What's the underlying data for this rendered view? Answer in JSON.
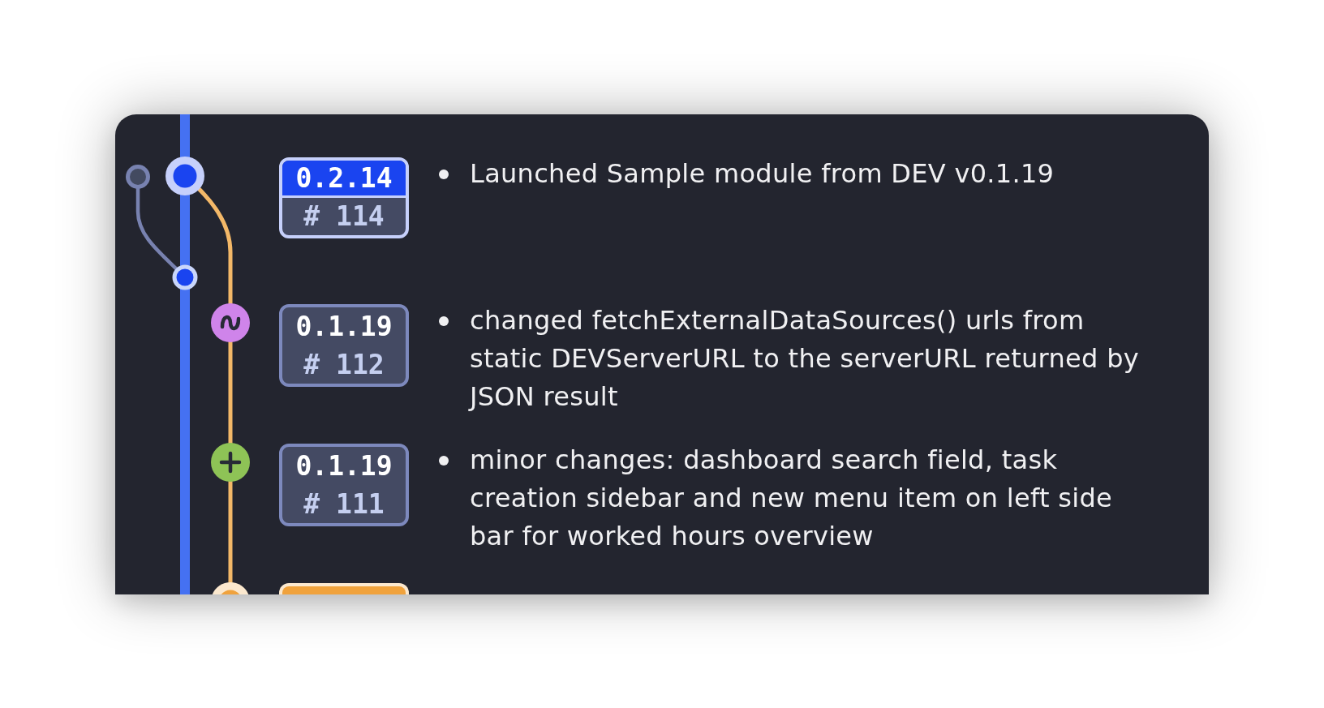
{
  "commits": [
    {
      "kind": "release",
      "on_main_branch": true,
      "color": "#1a44f0",
      "version": "0.2.14",
      "build": "# 114",
      "notes": [
        "Launched Sample module from DEV v0.1.19"
      ]
    },
    {
      "kind": "change",
      "on_main_branch": false,
      "color": "#cf84ea",
      "version": "0.1.19",
      "build": "# 112",
      "notes": [
        "changed fetchExternalDataSources() urls from static DEVServerURL to the serverURL returned by JSON result"
      ]
    },
    {
      "kind": "addition",
      "on_main_branch": false,
      "color": "#8ec356",
      "version": "0.1.19",
      "build": "# 111",
      "notes": [
        "minor changes: dashboard search field, task creation sidebar and new menu item on left side bar for worked hours overview"
      ]
    },
    {
      "kind": "release",
      "on_main_branch": false,
      "color": "#f0a23c"
    }
  ]
}
